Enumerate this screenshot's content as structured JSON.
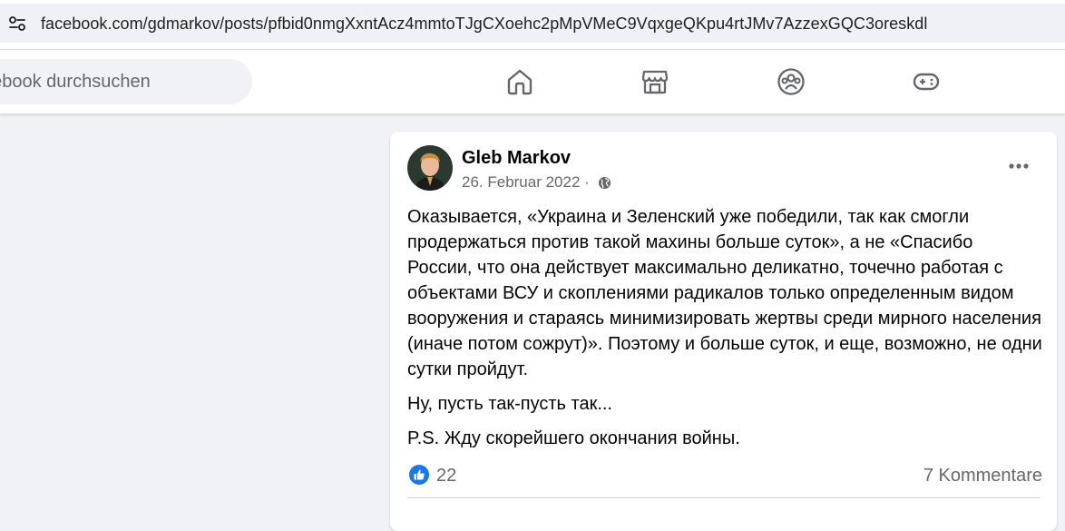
{
  "browser": {
    "url": "facebook.com/gdmarkov/posts/pfbid0nmgXxntAcz4mmtoTJgCXoehc2pMpVMeC9VqxgeQKpu4rtJMv7AzzexGQC3oreskdl"
  },
  "header": {
    "search_placeholder": "acebook durchsuchen",
    "nav_icons": [
      "home-icon",
      "marketplace-icon",
      "groups-icon",
      "gaming-icon"
    ]
  },
  "post": {
    "author": "Gleb Markov",
    "date": "26. Februar 2022 ·",
    "paragraphs": [
      "Оказывается, «Украина и Зеленский уже победили, так как смогли продержаться против такой махины больше суток», а не «Спасибо России, что она действует максимально деликатно, точечно работая с объектами ВСУ и скоплениями радикалов только определенным видом вооружения и стараясь минимизировать жертвы среди мирного населения (иначе потом сожрут)». Поэтому и больше суток, и еще, возможно, не одни сутки пройдут.",
      "Ну, пусть так-пусть так...",
      "P.S. Жду скорейшего окончания войны."
    ],
    "like_count": "22",
    "comments": "7 Kommentare"
  },
  "colors": {
    "accent": "#1877f2",
    "secondary_text": "#65676b",
    "background": "#f0f2f5"
  }
}
